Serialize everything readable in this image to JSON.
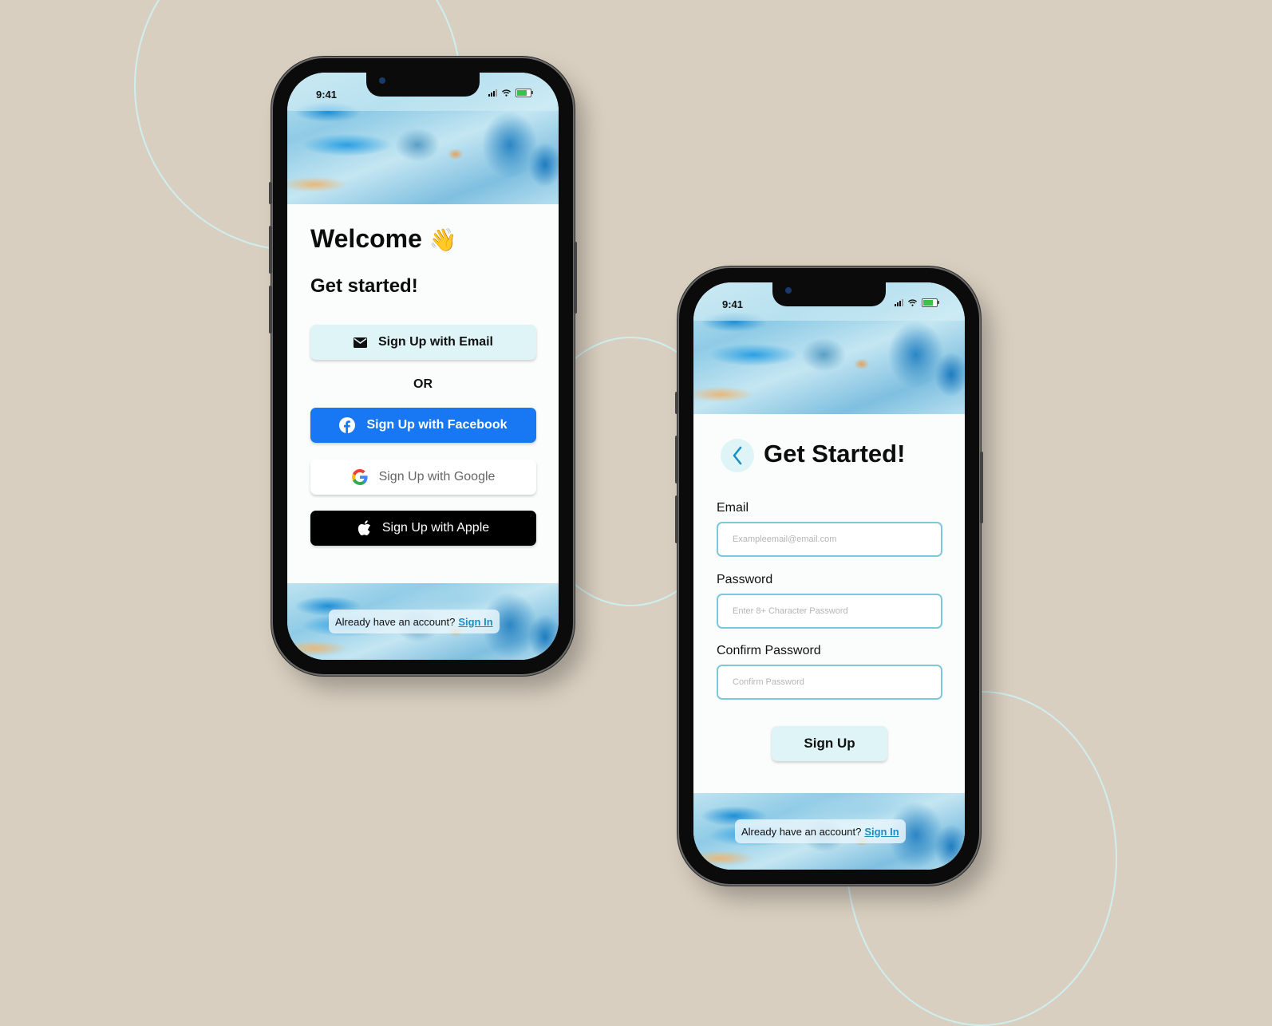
{
  "colors": {
    "background": "#d9cfc0",
    "accent_light": "#dff4f7",
    "facebook": "#1877f2",
    "apple": "#000000",
    "link": "#1b8fbf",
    "input_border": "#7cc7dc"
  },
  "phone_welcome": {
    "status": {
      "time": "9:41"
    },
    "title": "Welcome",
    "title_emoji": "👋",
    "subtitle": "Get started!",
    "buttons": {
      "email": {
        "label": "Sign Up with Email",
        "icon": "mail-icon"
      },
      "separator": "OR",
      "facebook": {
        "label": "Sign Up with Facebook",
        "icon": "facebook-icon"
      },
      "google": {
        "label": "Sign Up with Google",
        "icon": "google-icon"
      },
      "apple": {
        "label": "Sign Up with Apple",
        "icon": "apple-icon"
      }
    },
    "footer": {
      "text": "Already have an account?",
      "link": "Sign In"
    }
  },
  "phone_signup": {
    "status": {
      "time": "9:41"
    },
    "back_icon": "chevron-left-icon",
    "title": "Get Started!",
    "fields": {
      "email": {
        "label": "Email",
        "placeholder": "Exampleemail@email.com"
      },
      "password": {
        "label": "Password",
        "placeholder": "Enter 8+ Character Password"
      },
      "confirm": {
        "label": "Confirm Password",
        "placeholder": "Confirm Password"
      }
    },
    "submit": "Sign Up",
    "footer": {
      "text": "Already have an account?",
      "link": "Sign In"
    }
  }
}
